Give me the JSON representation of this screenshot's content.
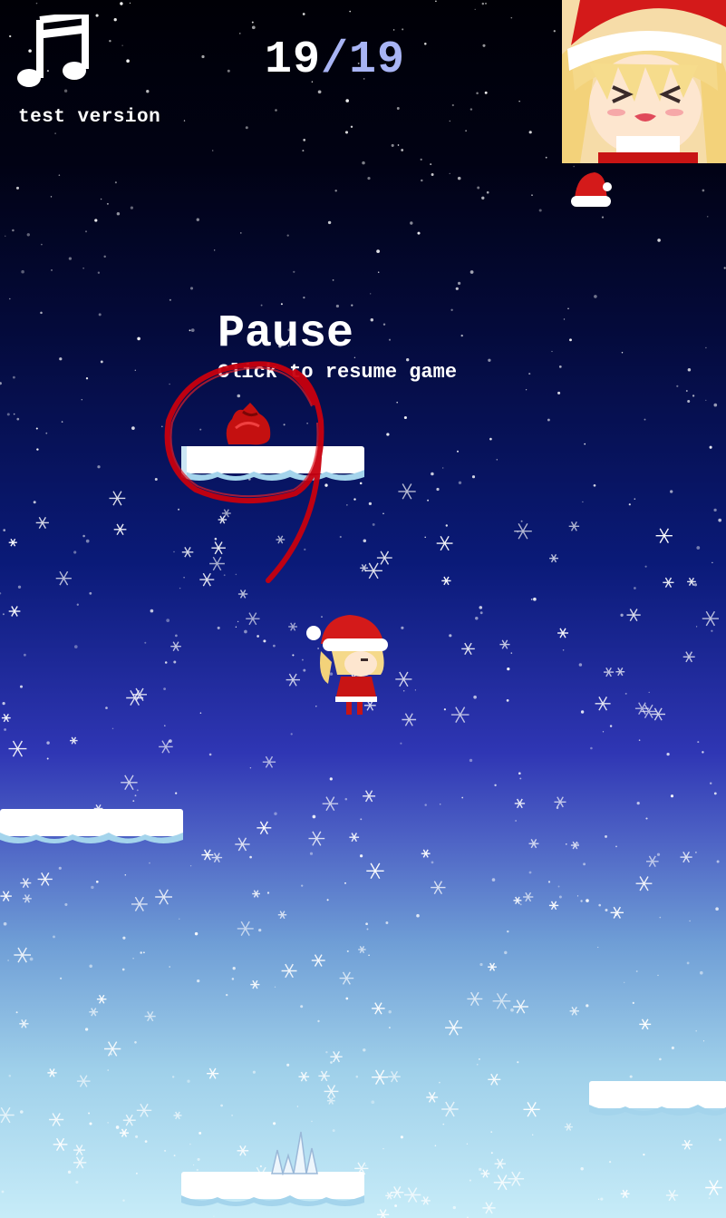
{
  "hud": {
    "version_label": "test version",
    "counter": {
      "current": "19",
      "separator": "/",
      "total": "19"
    }
  },
  "pause_overlay": {
    "title": "Pause",
    "subtitle": "Click to resume game"
  },
  "icons": {
    "music": "music-note-icon",
    "hat": "santa-hat-icon",
    "sack": "gift-sack-icon",
    "spikes": "ice-spike-icon"
  },
  "colors": {
    "counter_total": "#a8b4f4",
    "hat_red": "#d41a1a",
    "scribble": "#c8000e",
    "platform_snow": "#ffffff",
    "platform_shadow": "#a4d4ec"
  }
}
